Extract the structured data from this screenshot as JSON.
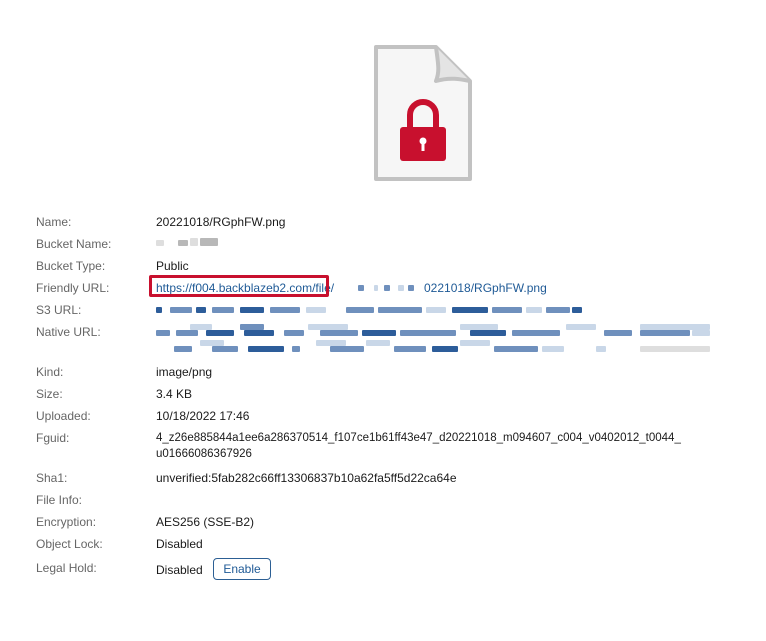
{
  "icon": {
    "name": "locked-file-icon",
    "lock_color": "#c8102e"
  },
  "details": [
    {
      "label": "Name:",
      "value": "20221018/RGphFW.png"
    },
    {
      "label": "Bucket Name:",
      "value": ""
    },
    {
      "label": "Bucket Type:",
      "value": "Public"
    },
    {
      "label": "Friendly URL:",
      "value_start": "https://f004.backblazeb2.com/file/",
      "value_end": "0221018/RGphFW.png"
    },
    {
      "label": "S3 URL:",
      "value": ""
    },
    {
      "label": "Native URL:",
      "value": ""
    },
    {
      "label": "Kind:",
      "value": "image/png"
    },
    {
      "label": "Size:",
      "value": "3.4 KB"
    },
    {
      "label": "Uploaded:",
      "value": "10/18/2022 17:46"
    },
    {
      "label": "Fguid:",
      "value_line1": "4_z26e885844a1ee6a286370514_f107ce1b61ff43e47_d20221018_m094607_c004_v0402012_t0044_",
      "value_line2": "u01666086367926"
    },
    {
      "label": "Sha1:",
      "value": "unverified:5fab282c66ff13306837b10a62fa5ff5d22ca64e"
    },
    {
      "label": "File Info:",
      "value": ""
    },
    {
      "label": "Encryption:",
      "value": "AES256 (SSE-B2)"
    },
    {
      "label": "Object Lock:",
      "value": "Disabled"
    },
    {
      "label": "Legal Hold:",
      "value": "Disabled",
      "button": "Enable"
    }
  ],
  "accent_color": "#1f5a96",
  "highlight_color": "#c8102e"
}
